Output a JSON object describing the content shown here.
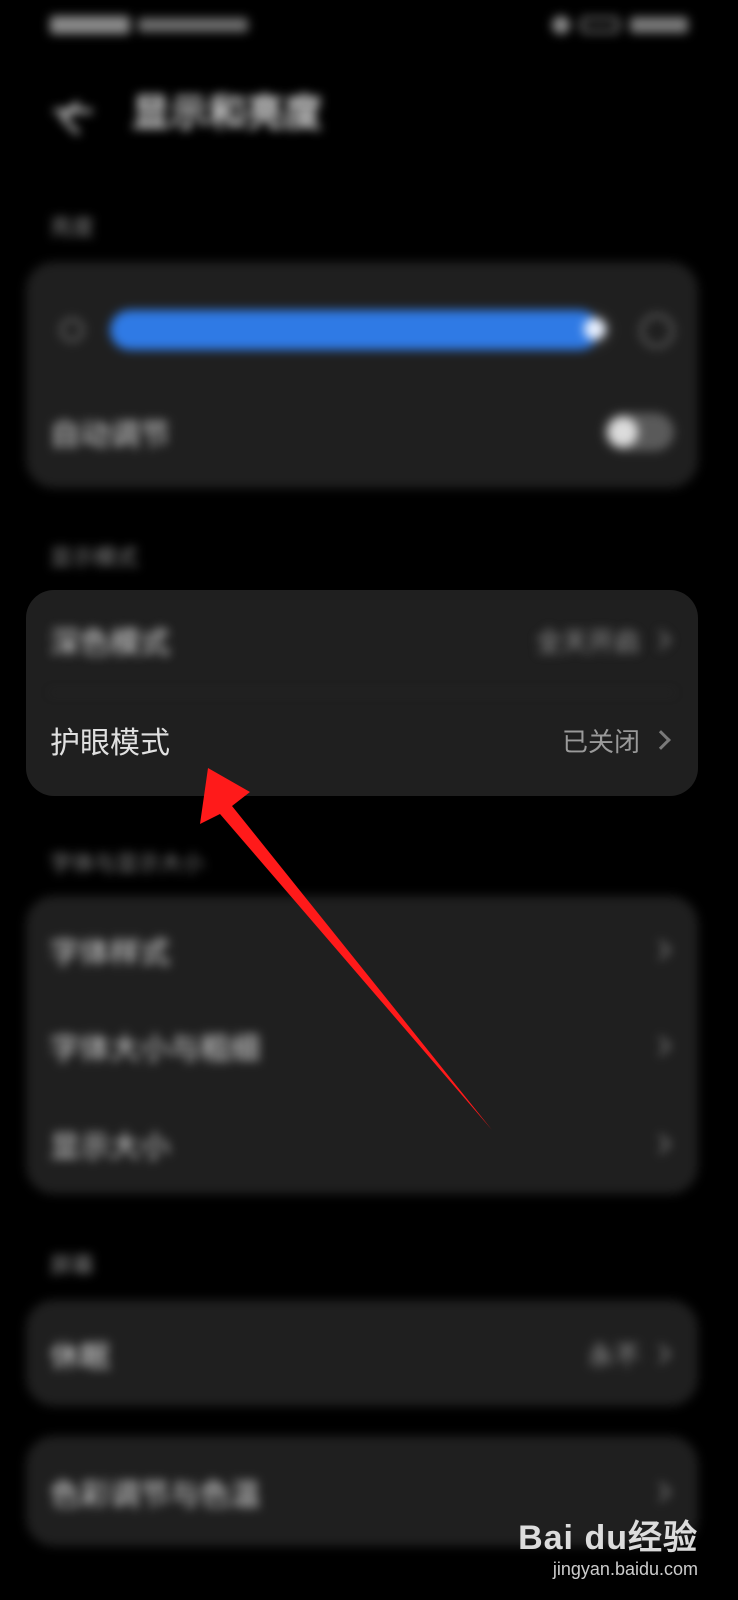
{
  "header": {
    "title": "显示和亮度"
  },
  "sections": {
    "brightness": {
      "label": "亮度",
      "auto_adjust_label": "自动调节",
      "auto_adjust_on": false,
      "level": 0.97
    },
    "display_mode": {
      "label": "显示模式",
      "items": [
        {
          "label": "深色模式",
          "value": "全天开启"
        },
        {
          "label": "护眼模式",
          "value": "已关闭"
        }
      ]
    },
    "font_display": {
      "label": "字体与显示大小",
      "items": [
        {
          "label": "字体样式"
        },
        {
          "label": "字体大小与粗细"
        },
        {
          "label": "显示大小"
        }
      ]
    },
    "screen": {
      "label": "屏幕",
      "items": [
        {
          "label": "休眠",
          "value": "永不"
        },
        {
          "label": "色彩调节与色温"
        }
      ]
    }
  },
  "watermark": {
    "logo": "Bai du经验",
    "url": "jingyan.baidu.com"
  },
  "colors": {
    "accent": "#2f7ae5",
    "arrow": "#ff1a1a",
    "card": "#1f1f1f"
  }
}
